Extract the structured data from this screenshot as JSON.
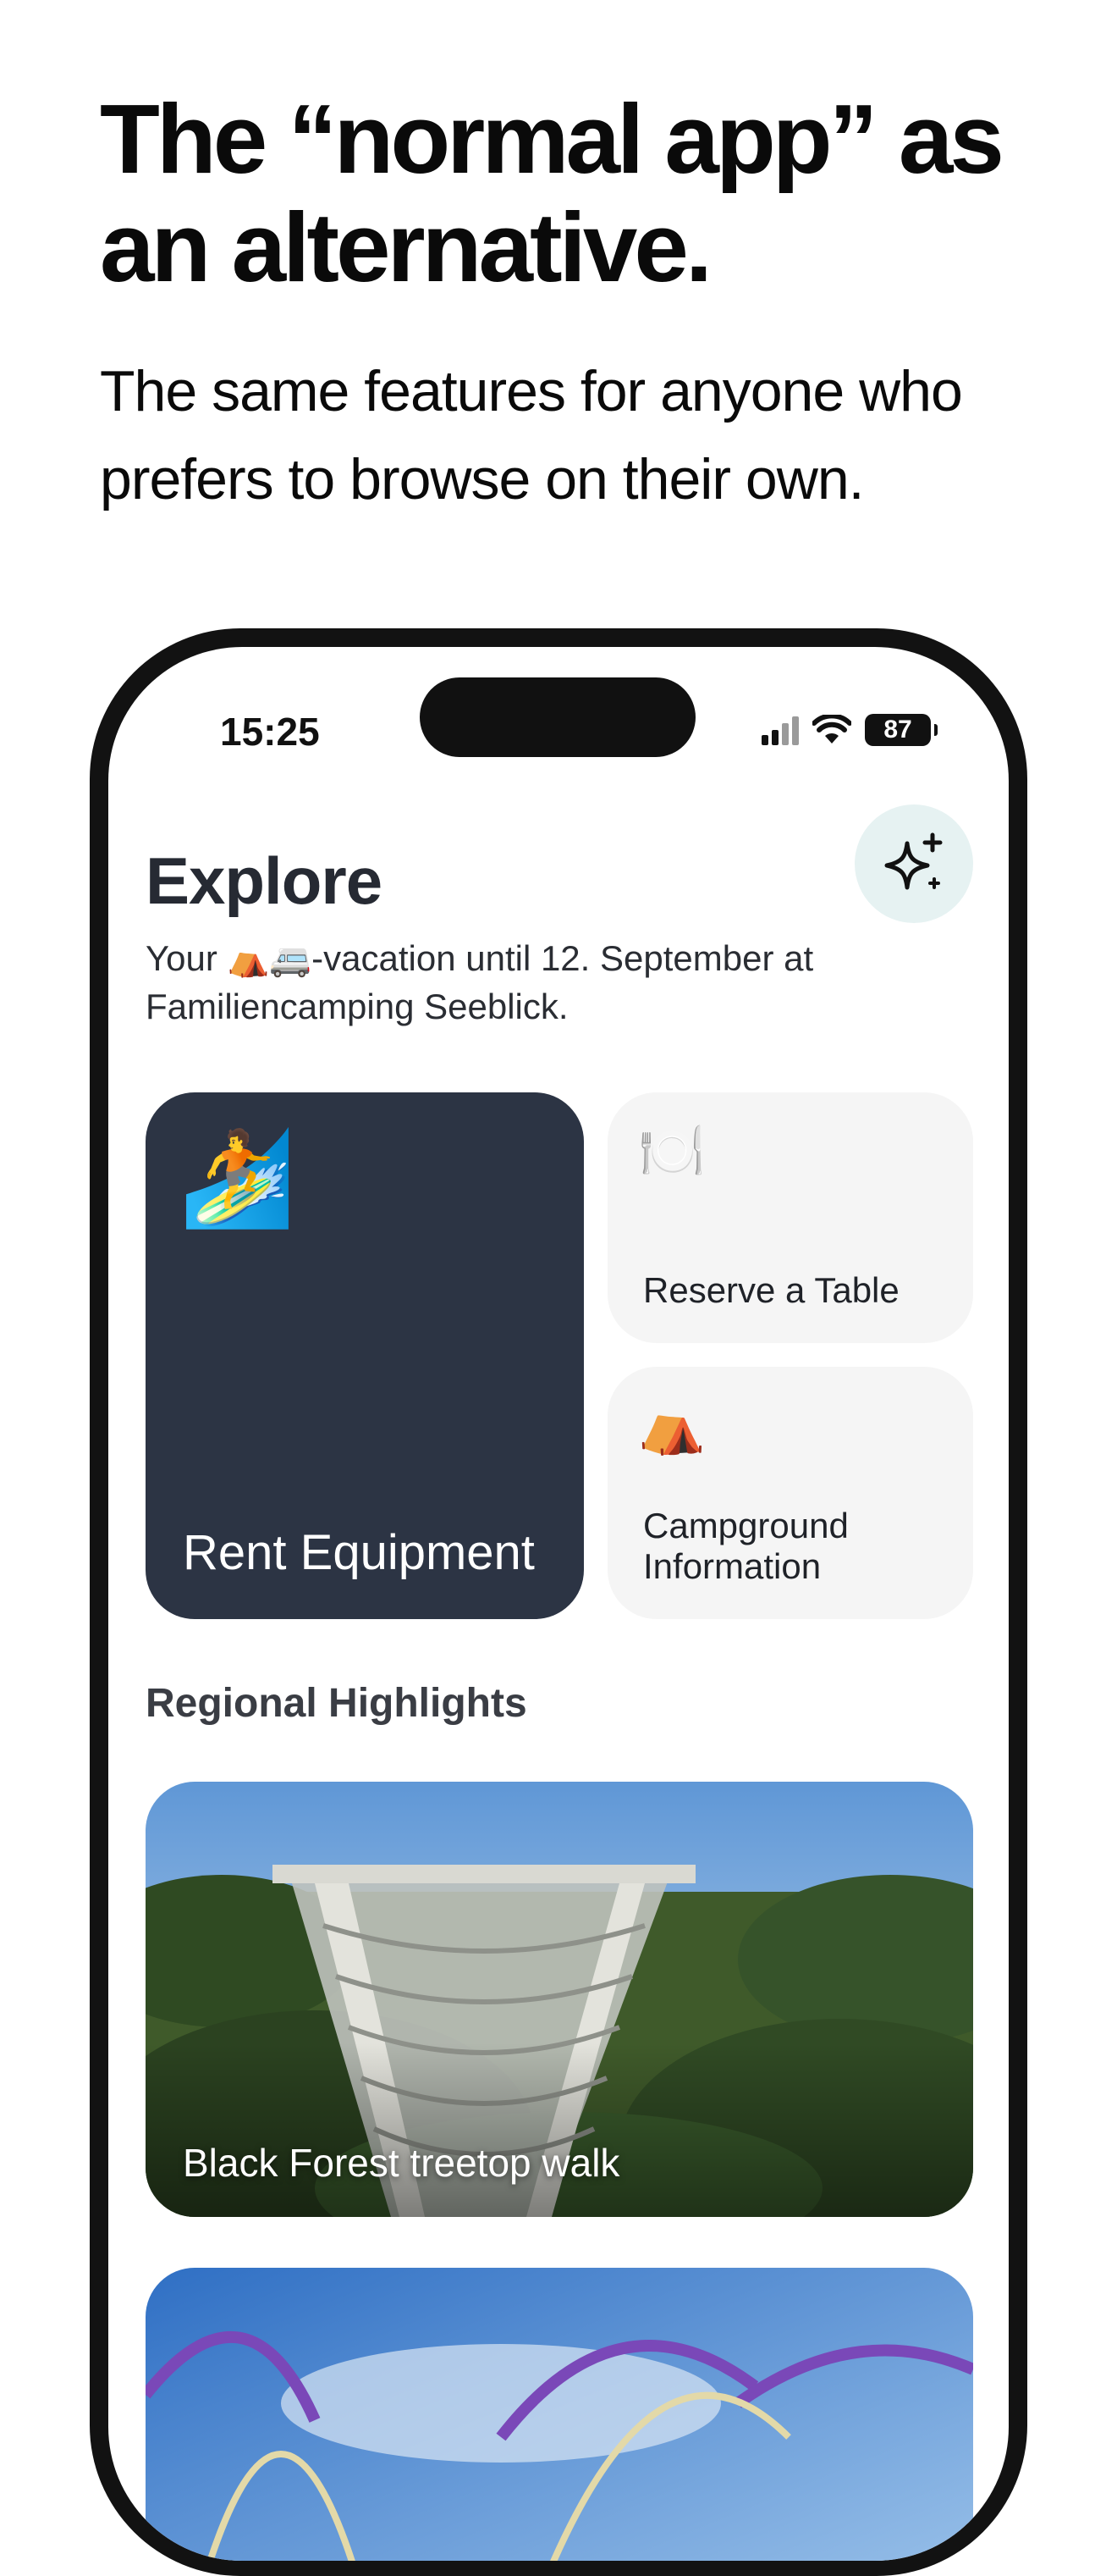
{
  "marketing": {
    "headline": "The “normal app” as an alternative.",
    "subline": "The same features for anyone who prefers to browse on their own."
  },
  "status_bar": {
    "time": "15:25",
    "battery": "87",
    "icons": [
      "signal-icon",
      "wifi-icon",
      "battery-icon"
    ]
  },
  "header": {
    "title": "Explore",
    "ai_button_icon": "sparkles-icon",
    "subtitle_before": "Your ",
    "subtitle_emoji": "⛺🚐",
    "subtitle_after": "-vacation until 12. September at Familiencamping Seeblick."
  },
  "tiles": [
    {
      "emoji": "🏄",
      "icon": "surfer-icon",
      "label": "Rent Equipment"
    },
    {
      "emoji": "🍽️",
      "icon": "plate-cutlery-icon",
      "label": "Reserve a Table"
    },
    {
      "emoji": "⛺",
      "icon": "tent-icon",
      "label": "Campground Information"
    }
  ],
  "highlights": {
    "title": "Regional Highlights",
    "cards": [
      {
        "caption": "Black Forest treetop walk"
      },
      {
        "caption": ""
      }
    ]
  },
  "colors": {
    "dark_tile": "#2c3444",
    "light_tile": "#f5f5f5",
    "ai_button": "#e6f2f2",
    "phone_frame": "#121212"
  }
}
